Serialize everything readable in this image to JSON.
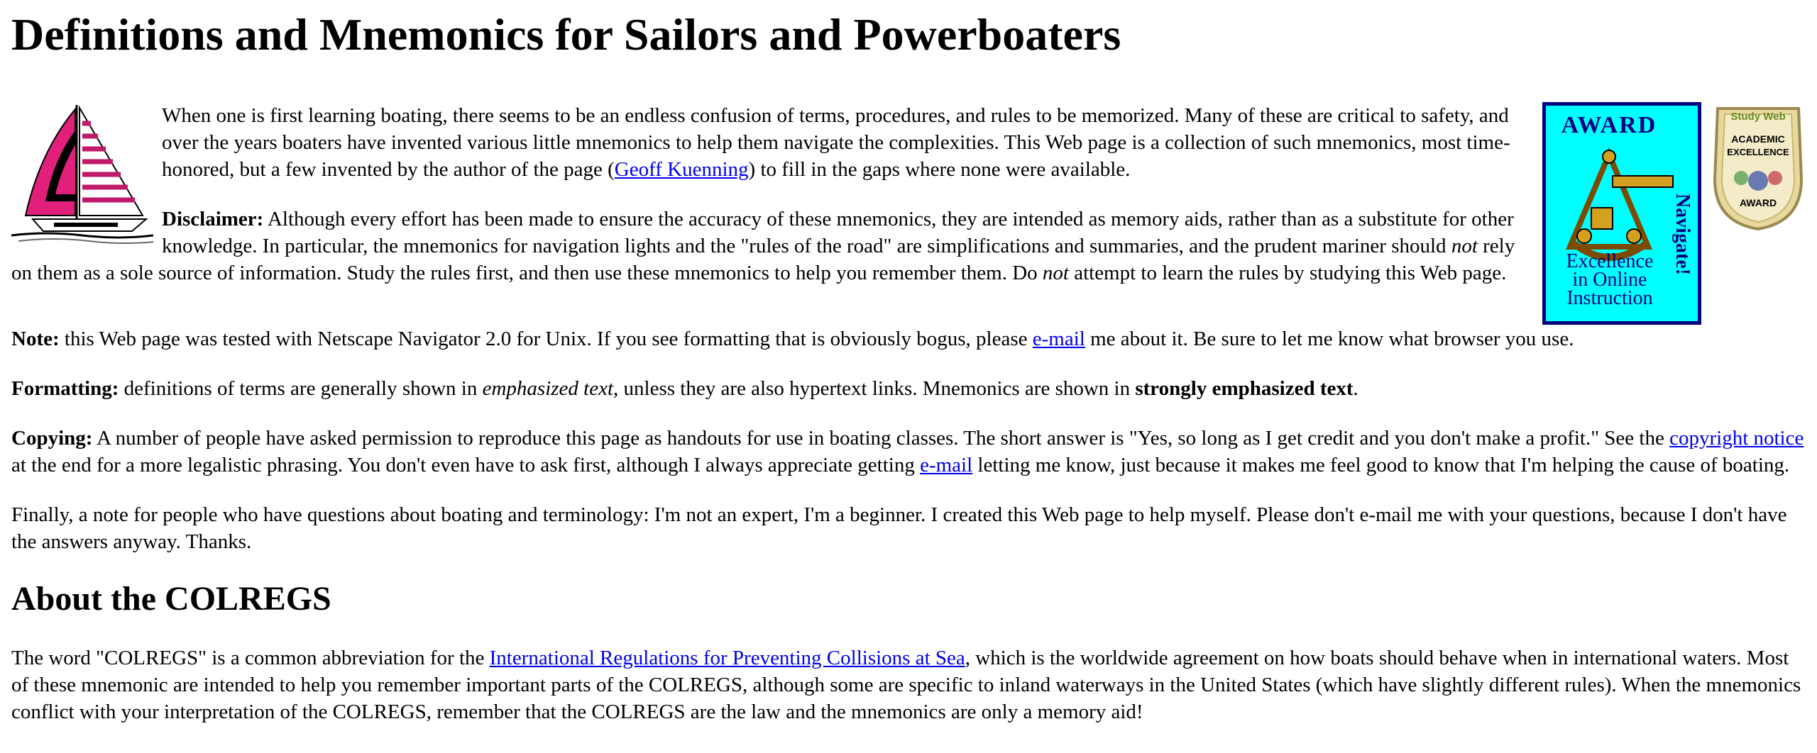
{
  "title": "Definitions and Mnemonics for Sailors and Powerboaters",
  "intro": {
    "text_a": "When one is first learning boating, there seems to be an endless confusion of terms, procedures, and rules to be memorized. Many of these are critical to safety, and over the years boaters have invented various little mnemonics to help them navigate the complexities. This Web page is a collection of such mnemonics, most time-honored, but a few invented by the author of the page (",
    "author_link": "Geoff Kuenning",
    "text_b": ") to fill in the gaps where none were available."
  },
  "disclaimer": {
    "label": "Disclaimer:",
    "text_a": " Although every effort has been made to ensure the accuracy of these mnemonics, they are intended as memory aids, rather than as a substitute for other knowledge. In particular, the mnemonics for navigation lights and the \"rules of the road\" are simplifications and summaries, and the prudent mariner should ",
    "em1": "not",
    "text_b": " rely on them as a sole source of information. Study the rules first, and then use these mnemonics to help you remember them. Do ",
    "em2": "not",
    "text_c": " attempt to learn the rules by studying this Web page."
  },
  "note": {
    "label": "Note:",
    "text_a": " this Web page was tested with Netscape Navigator 2.0 for Unix. If you see formatting that is obviously bogus, please ",
    "email_link": "e-mail",
    "text_b": " me about it. Be sure to let me know what browser you use."
  },
  "formatting": {
    "label": "Formatting:",
    "text_a": " definitions of terms are generally shown in ",
    "em": "emphasized text",
    "text_b": ", unless they are also hypertext links. Mnemonics are shown in ",
    "strong": "strongly emphasized text",
    "text_c": "."
  },
  "copying": {
    "label": "Copying:",
    "text_a": " A number of people have asked permission to reproduce this page as handouts for use in boating classes. The short answer is \"Yes, so long as I get credit and you don't make a profit.\" See the ",
    "copyright_link": "copyright notice",
    "text_b": " at the end for a more legalistic phrasing. You don't even have to ask first, although I always appreciate getting ",
    "email_link": "e-mail",
    "text_c": " letting me know, just because it makes me feel good to know that I'm helping the cause of boating."
  },
  "finally": {
    "text": "Finally, a note for people who have questions about boating and terminology: I'm not an expert, I'm a beginner. I created this Web page to help myself. Please don't e-mail me with your questions, because I don't have the answers anyway. Thanks."
  },
  "colregs": {
    "heading": "About the COLREGS",
    "text_a": "The word \"COLREGS\" is a common abbreviation for the ",
    "link": "International Regulations for Preventing Collisions at Sea",
    "text_b": ", which is the worldwide agreement on how boats should behave when in international waters. Most of these mnemonic are intended to help you remember important parts of the COLREGS, although some are specific to inland waterways in the United States (which have slightly different rules). When the mnemonics conflict with your interpretation of the COLREGS, remember that the COLREGS are the law and the mnemonics are only a memory aid!"
  },
  "award": {
    "top": "AWARD",
    "side": "Navigate!",
    "line1": "Excellence",
    "line2": "in Online",
    "line3": "Instruction"
  },
  "academic_award": {
    "top": "Study Web",
    "line1": "ACADEMIC",
    "line2": "EXCELLENCE",
    "line3": "AWARD"
  },
  "colors": {
    "link": "#0000ee",
    "award_bg": "#00ffff",
    "award_border": "#000080",
    "sail_pink": "#e0207a"
  }
}
